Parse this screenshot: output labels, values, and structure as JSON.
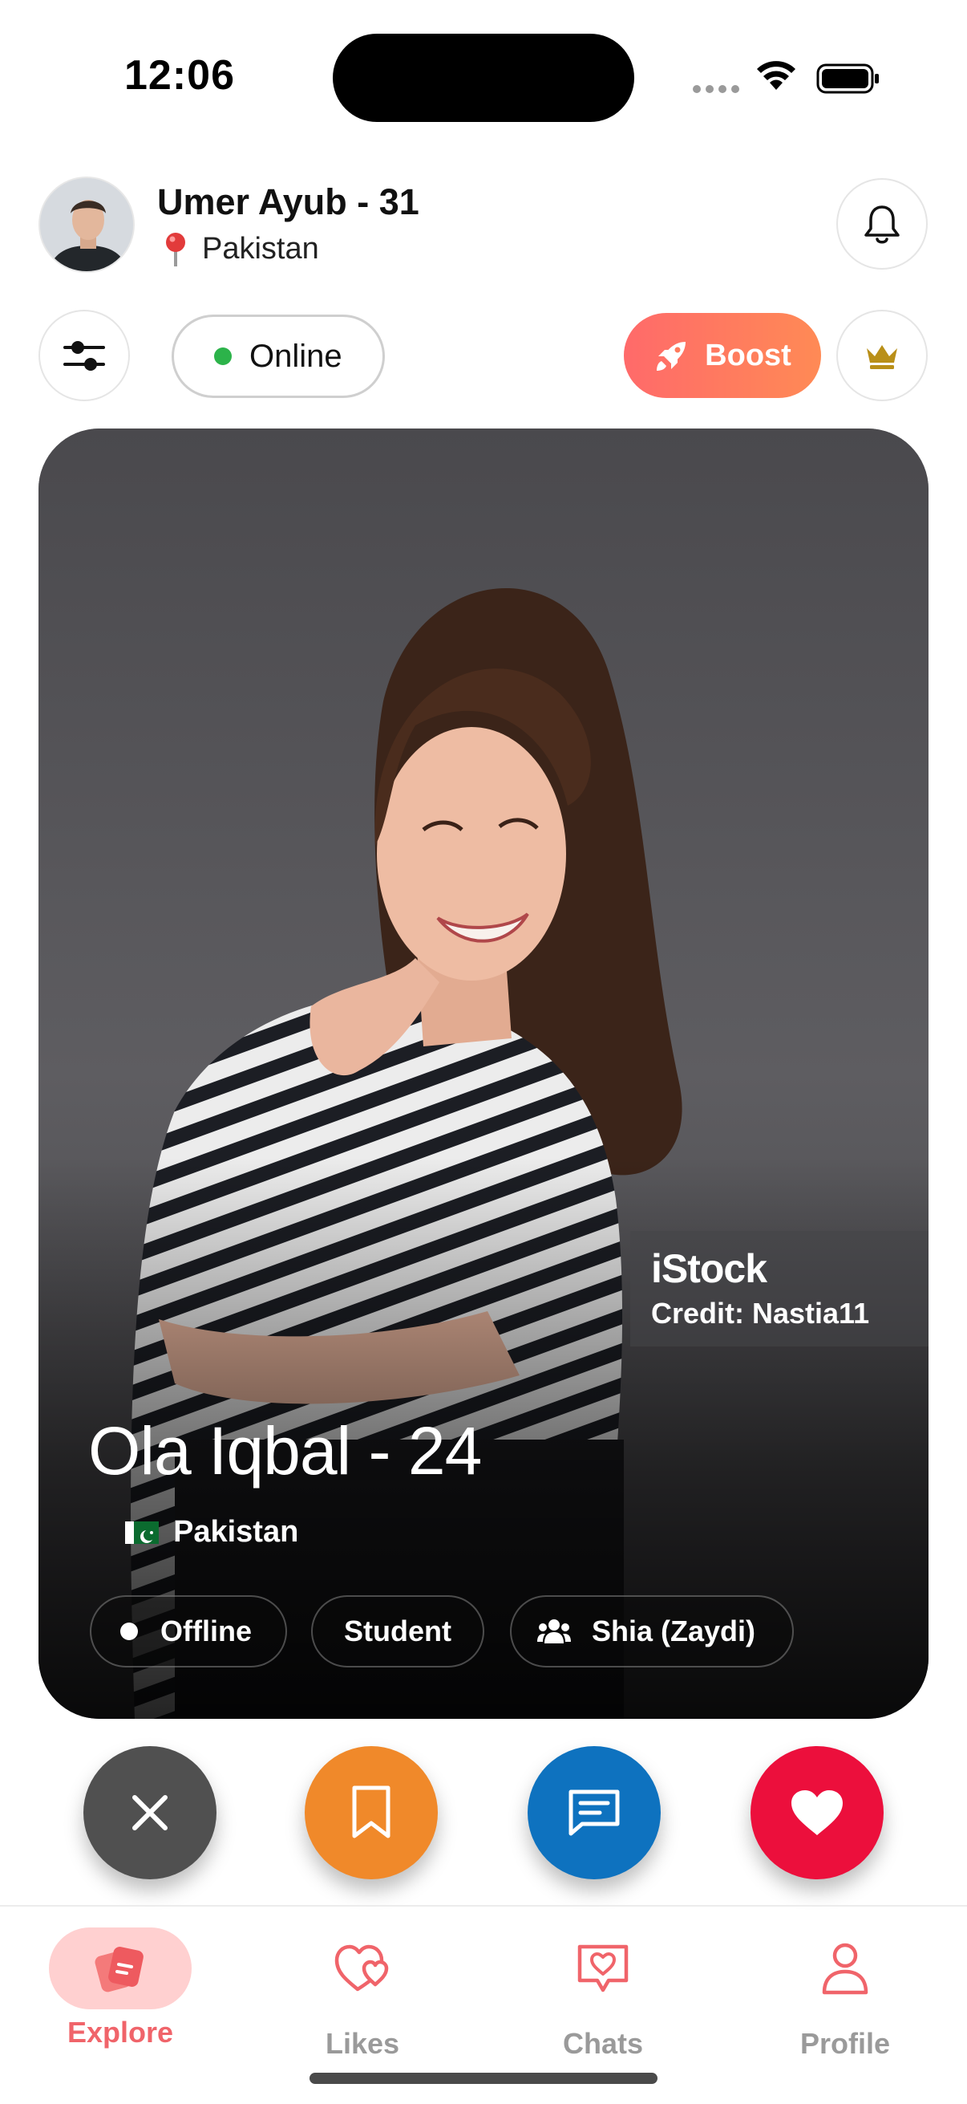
{
  "status_bar": {
    "time": "12:06"
  },
  "header": {
    "user_name": "Umer Ayub - 31",
    "location": "Pakistan",
    "presence_label": "Online",
    "boost_label": "Boost"
  },
  "card": {
    "name": "Ola Iqbal - 24",
    "country": "Pakistan",
    "watermark_brand": "iStock",
    "watermark_credit": "Credit: Nastia11",
    "tags": {
      "status": "Offline",
      "occupation": "Student",
      "sect": "Shia (Zaydi)"
    }
  },
  "nav": {
    "items": [
      {
        "label": "Explore",
        "active": true
      },
      {
        "label": "Likes",
        "active": false
      },
      {
        "label": "Chats",
        "active": false
      },
      {
        "label": "Profile",
        "active": false
      }
    ]
  },
  "colors": {
    "accent": "#f0646a",
    "online": "#2cb34a",
    "dislike": "#505050",
    "save": "#f0892a",
    "chat": "#0e72bf",
    "like": "#ec0f3c"
  },
  "icons": [
    "wifi-icon",
    "battery-icon",
    "bell-icon",
    "sliders-icon",
    "crown-icon",
    "rocket-icon",
    "pin-icon",
    "users-icon",
    "close-icon",
    "bookmark-icon",
    "message-icon",
    "heart-icon",
    "cards-icon",
    "person-icon"
  ]
}
